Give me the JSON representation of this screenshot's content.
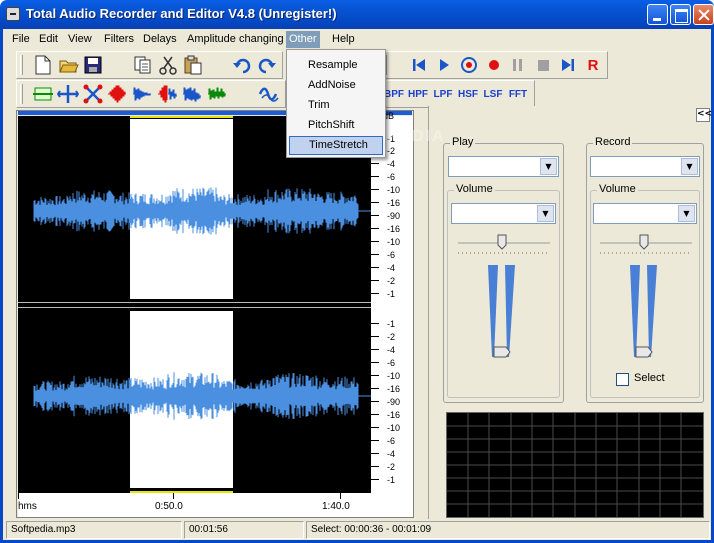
{
  "window": {
    "title": "Total Audio Recorder and Editor V4.8 (Unregister!)"
  },
  "menu": [
    "File",
    "Edit",
    "View",
    "Filters",
    "Delays",
    "Amplitude changing",
    "Other",
    "Help"
  ],
  "active_menu": "Other",
  "dropdown": {
    "items": [
      "Resample",
      "AddNoise",
      "Trim",
      "PitchShift",
      "TimeStretch"
    ],
    "highlighted": "TimeStretch"
  },
  "toolbar": {
    "file_buttons": [
      "new-icon",
      "open-icon",
      "save-icon"
    ],
    "edit_buttons": [
      "copy-icon",
      "cut-icon",
      "paste-icon"
    ],
    "history_buttons": [
      "undo-icon",
      "redo-icon"
    ],
    "transport_buttons": [
      "skip-start-icon",
      "play-icon",
      "loop-play-icon",
      "record-icon",
      "pause-icon",
      "stop-icon",
      "skip-end-icon",
      "register-icon"
    ],
    "register_label": "R",
    "filter_labels": [
      "BPF",
      "HPF",
      "LPF",
      "HSF",
      "LSF",
      "FFT"
    ]
  },
  "waveform": {
    "db_unit": "dB",
    "db_labels_top": [
      "-1",
      "-2",
      "-4",
      "-6",
      "-10",
      "-16",
      "-90",
      "-16",
      "-10",
      "-6",
      "-4",
      "-2",
      "-1"
    ],
    "db_labels_bottom": [
      "-1",
      "-2",
      "-4",
      "-6",
      "-10",
      "-16",
      "-90",
      "-16",
      "-10",
      "-6",
      "-4",
      "-2",
      "-1"
    ],
    "time_unit": "hms",
    "time_labels": [
      "0:50.0",
      "1:40.0"
    ],
    "wave_color": "#4a8fe0",
    "selection_color": "#ffffff"
  },
  "watermark": "SOFTPEDIA",
  "play_panel": {
    "title": "Play",
    "volume_label": "Volume",
    "device_value": "",
    "volume_value": ""
  },
  "record_panel": {
    "title": "Record",
    "volume_label": "Volume",
    "device_value": "",
    "volume_value": "",
    "select_label": "Select"
  },
  "collapse_label": "<<",
  "status": {
    "file": "Softpedia.mp3",
    "duration": "00:01:56",
    "selection": "Select: 00:00:36 - 00:01:09"
  }
}
